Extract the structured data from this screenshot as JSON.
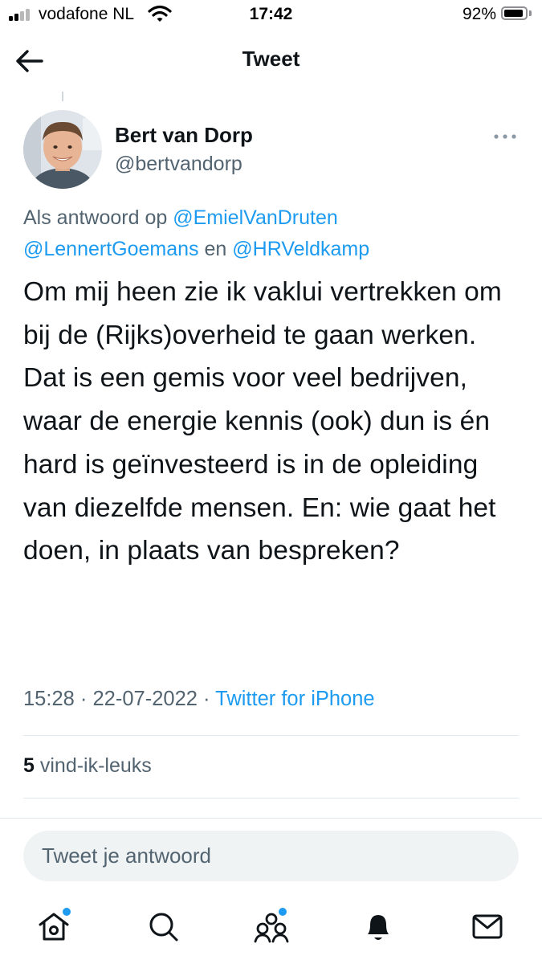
{
  "status_bar": {
    "carrier": "vodafone NL",
    "time": "17:42",
    "battery_percent": "92%",
    "battery_level": 0.92,
    "signal_bars_filled": 2,
    "signal_bars_total": 4
  },
  "header": {
    "title": "Tweet",
    "back_icon": "arrow-left-icon"
  },
  "tweet": {
    "author": {
      "display_name": "Bert van Dorp",
      "handle": "@bertvandorp"
    },
    "more_icon": "more-dots-icon",
    "reply_context": {
      "prefix": "Als antwoord op",
      "mention_1": "@EmielVanDruten",
      "mention_2": "@LennertGoemans",
      "joiner": "en",
      "mention_3": "@HRVeldkamp"
    },
    "text": "Om mij heen zie ik vaklui vertrekken om bij de (Rijks)overheid te gaan werken. Dat is een gemis voor veel bedrijven, waar de energie kennis (ook) dun is én hard is geïnvesteerd is in de opleiding van diezelfde mensen. En: wie gaat het doen, in plaats van bespreken?",
    "time": "15:28",
    "separator": "·",
    "date": "22-07-2022",
    "source": "Twitter for iPhone",
    "likes_count": "5",
    "likes_label": "vind-ik-leuks"
  },
  "composer": {
    "placeholder": "Tweet je antwoord"
  },
  "tab_bar": {
    "items": [
      {
        "icon": "home-icon",
        "has_dot": true
      },
      {
        "icon": "search-icon",
        "has_dot": false
      },
      {
        "icon": "communities-icon",
        "has_dot": true
      },
      {
        "icon": "notifications-bell-icon",
        "has_dot": false
      },
      {
        "icon": "messages-envelope-icon",
        "has_dot": false
      }
    ]
  },
  "colors": {
    "accent": "#1d9bf0",
    "text_primary": "#0f1419",
    "text_secondary": "#536471",
    "divider": "#e1e8ed"
  }
}
